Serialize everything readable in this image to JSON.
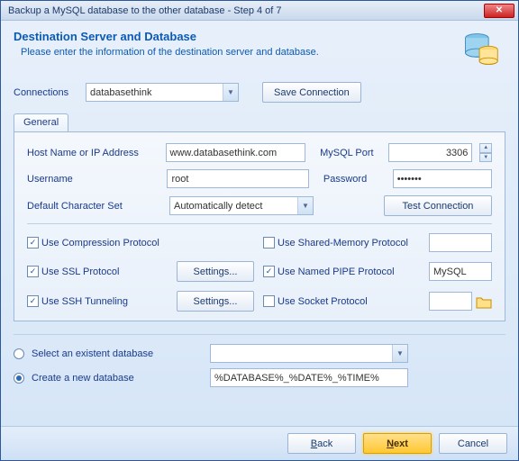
{
  "window": {
    "title": "Backup a MySQL database to the other database - Step 4 of 7"
  },
  "header": {
    "title": "Destination Server and Database",
    "subtitle": "Please enter the information of the destination server and database."
  },
  "connections": {
    "label": "Connections",
    "value": "databasethink",
    "save_btn": "Save Connection"
  },
  "tabs": {
    "general": "General"
  },
  "form": {
    "host_label": "Host Name or IP Address",
    "host_value": "www.databasethink.com",
    "port_label": "MySQL Port",
    "port_value": "3306",
    "user_label": "Username",
    "user_value": "root",
    "pass_label": "Password",
    "pass_value": "•••••••",
    "charset_label": "Default Character Set",
    "charset_value": "Automatically detect",
    "test_btn": "Test Connection"
  },
  "opts": {
    "compression": {
      "label": "Use Compression Protocol",
      "checked": true
    },
    "ssl": {
      "label": "Use SSL Protocol",
      "checked": true,
      "btn": "Settings..."
    },
    "ssh": {
      "label": "Use SSH Tunneling",
      "checked": true,
      "btn": "Settings..."
    },
    "shared": {
      "label": "Use Shared-Memory Protocol",
      "checked": false,
      "value": ""
    },
    "pipe": {
      "label": "Use Named PIPE Protocol",
      "checked": true,
      "value": "MySQL"
    },
    "socket": {
      "label": "Use Socket Protocol",
      "checked": false,
      "value": ""
    }
  },
  "db": {
    "select_label": "Select an existent database",
    "select_value": "",
    "create_label": "Create a new database",
    "create_value": "%DATABASE%_%DATE%_%TIME%",
    "mode": "create"
  },
  "footer": {
    "back": "Back",
    "next": "Next",
    "cancel": "Cancel"
  }
}
